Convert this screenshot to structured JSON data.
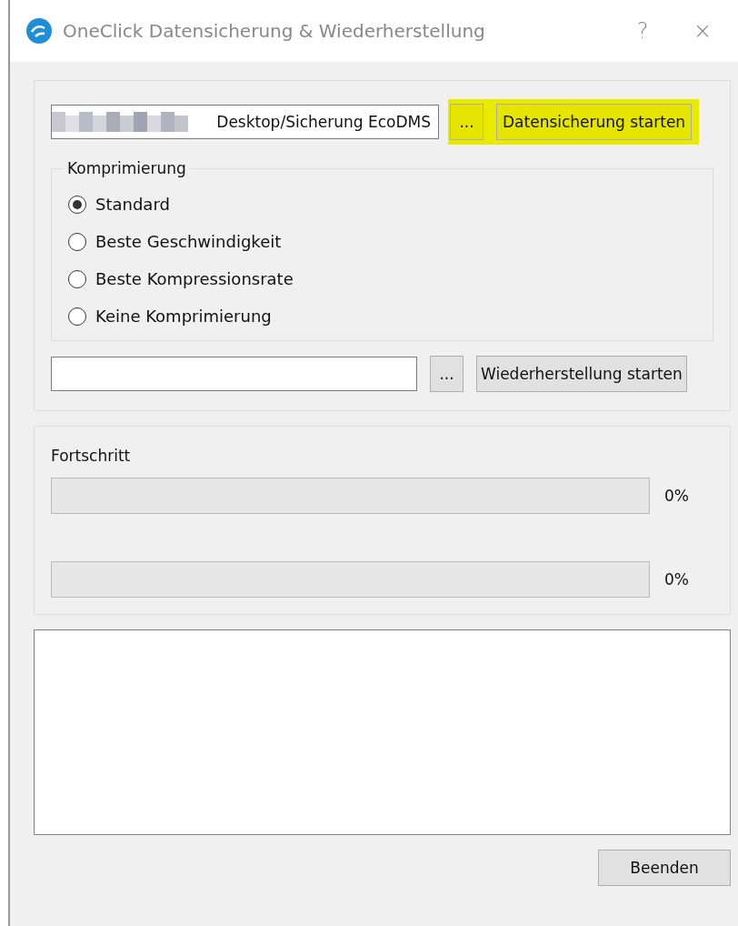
{
  "window": {
    "title": "OneClick Datensicherung & Wiederherstellung",
    "help": "?",
    "close": "×"
  },
  "backup": {
    "path": {
      "value": "Desktop/Sicherung EcoDMS",
      "redacted": true
    },
    "browse": {
      "label": "...",
      "highlighted": true
    },
    "start": {
      "label": "Datensicherung starten",
      "highlighted": true
    }
  },
  "compression": {
    "title": "Komprimierung",
    "options": [
      {
        "label": "Standard",
        "selected": true
      },
      {
        "label": "Beste Geschwindigkeit",
        "selected": false
      },
      {
        "label": "Beste Kompressionsrate",
        "selected": false
      },
      {
        "label": "Keine Komprimierung",
        "selected": false
      }
    ]
  },
  "restore": {
    "browse": {
      "label": "...",
      "highlighted": false
    },
    "start": {
      "label": "Wiederherstellung starten",
      "highlighted": false
    }
  },
  "progress": {
    "title": "Fortschritt",
    "bars": [
      {
        "level": 0,
        "reading": "0%"
      },
      {
        "level": 0,
        "reading": "0%"
      }
    ]
  },
  "buttons": [
    {
      "label": "Beenden"
    }
  ]
}
